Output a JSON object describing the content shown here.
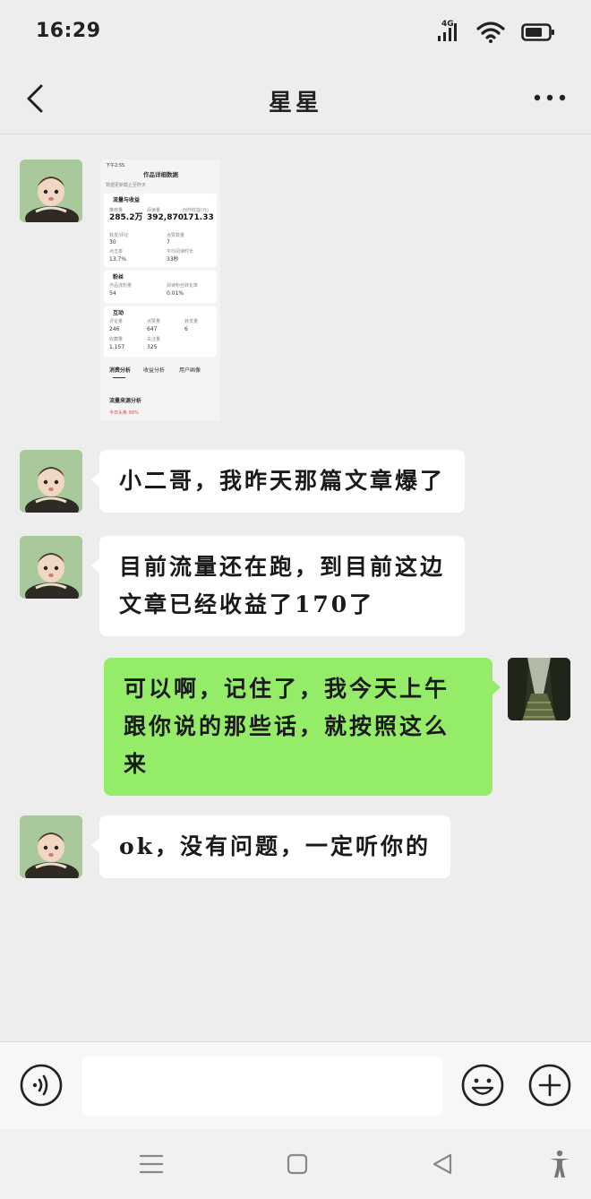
{
  "status_bar": {
    "time": "16:29",
    "network": "4G",
    "icons": [
      "signal-icon",
      "wifi-icon",
      "battery-icon"
    ]
  },
  "header": {
    "title": "星星",
    "back_icon": "chevron-left-icon",
    "more_icon": "more-dots-icon"
  },
  "image_message": {
    "status_time": "下午2:55",
    "page_title": "作品详细数据",
    "hint": "数据更新截止至昨天",
    "section_traffic": "流量与收益",
    "label_recommend": "推荐量",
    "value_recommend": "285.2万",
    "label_read": "阅读量",
    "value_read": "392,870",
    "label_income": "创作收益(元)",
    "value_income": "171.33",
    "label_a": "转发/评论",
    "value_a": "30",
    "label_b": "点赞数量",
    "value_b": "7",
    "label_c": "点击率",
    "value_c": "13.7%",
    "label_d": "平均阅读时长",
    "value_d": "33秒",
    "section_fans": "粉丝",
    "label_fans_gain": "作品涨粉量",
    "value_fans_gain": "54",
    "label_fans_rate": "阅读粉丝转化率",
    "value_fans_rate": "0.01%",
    "section_interact": "互动",
    "label_comments": "评论量",
    "value_comments": "246",
    "label_likes": "点赞量",
    "value_likes": "647",
    "label_shares": "转发量",
    "value_shares": "6",
    "label_collect": "收藏量",
    "value_collect": "1,157",
    "label_follow": "关注量",
    "value_follow": "325",
    "tab_consume": "消费分析",
    "tab_income": "收益分析",
    "tab_users": "用户画像",
    "source_title": "流量来源分析",
    "source_pct": "今日头条 99%"
  },
  "messages": [
    {
      "side": "left",
      "text": "小二哥，我昨天那篇文章爆了"
    },
    {
      "side": "left",
      "lines": [
        "目前流量还在跑，到目前这边",
        "文章已经收益了170了"
      ]
    },
    {
      "side": "right",
      "lines": [
        "可以啊，记住了，我今天上午",
        "跟你说的那些话，就按照这么",
        "来"
      ]
    },
    {
      "side": "left",
      "text": "ok，没有问题，一定听你的"
    }
  ],
  "input_bar": {
    "placeholder": "",
    "voice_icon": "voice-icon",
    "emoji_icon": "emoji-icon",
    "plus_icon": "plus-icon"
  },
  "system_nav": {
    "icons": [
      "menu-icon",
      "home-square-icon",
      "back-triangle-icon",
      "accessibility-icon"
    ]
  },
  "colors": {
    "background": "#ededed",
    "bubble_left": "#ffffff",
    "bubble_right": "#95ec69"
  }
}
